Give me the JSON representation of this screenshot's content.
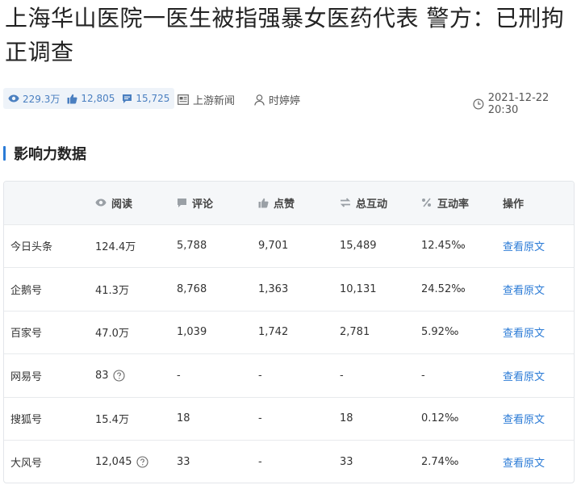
{
  "article": {
    "title": "上海华山医院一医生被指强暴女医药代表 警方：已刑拘正调查"
  },
  "meta": {
    "views": "229.3万",
    "likes": "12,805",
    "comments": "15,725",
    "source": "上游新闻",
    "author": "时婷婷",
    "datetime": "2021-12-22 20:30"
  },
  "section": {
    "title": "影响力数据"
  },
  "table": {
    "headers": {
      "read": "阅读",
      "comment": "评论",
      "like": "点赞",
      "interact": "总互动",
      "rate": "互动率",
      "action": "操作"
    },
    "rows": [
      {
        "platform": "今日头条",
        "read": "124.4万",
        "comment": "5,788",
        "like": "9,701",
        "interact": "15,489",
        "rate": "12.45‰",
        "action": "查看原文"
      },
      {
        "platform": "企鹅号",
        "read": "41.3万",
        "comment": "8,768",
        "like": "1,363",
        "interact": "10,131",
        "rate": "24.52‰",
        "action": "查看原文"
      },
      {
        "platform": "百家号",
        "read": "47.0万",
        "comment": "1,039",
        "like": "1,742",
        "interact": "2,781",
        "rate": "5.92‰",
        "action": "查看原文"
      },
      {
        "platform": "网易号",
        "read": "83",
        "comment": "-",
        "like": "-",
        "interact": "-",
        "rate": "-",
        "action": "查看原文"
      },
      {
        "platform": "搜狐号",
        "read": "15.4万",
        "comment": "18",
        "like": "-",
        "interact": "18",
        "rate": "0.12‰",
        "action": "查看原文"
      },
      {
        "platform": "大风号",
        "read": "12,045",
        "comment": "33",
        "like": "-",
        "interact": "33",
        "rate": "2.74‰",
        "action": "查看原文"
      }
    ]
  },
  "colors": {
    "accent": "#2b7bd6",
    "stat_blue": "#4a7fc0"
  }
}
